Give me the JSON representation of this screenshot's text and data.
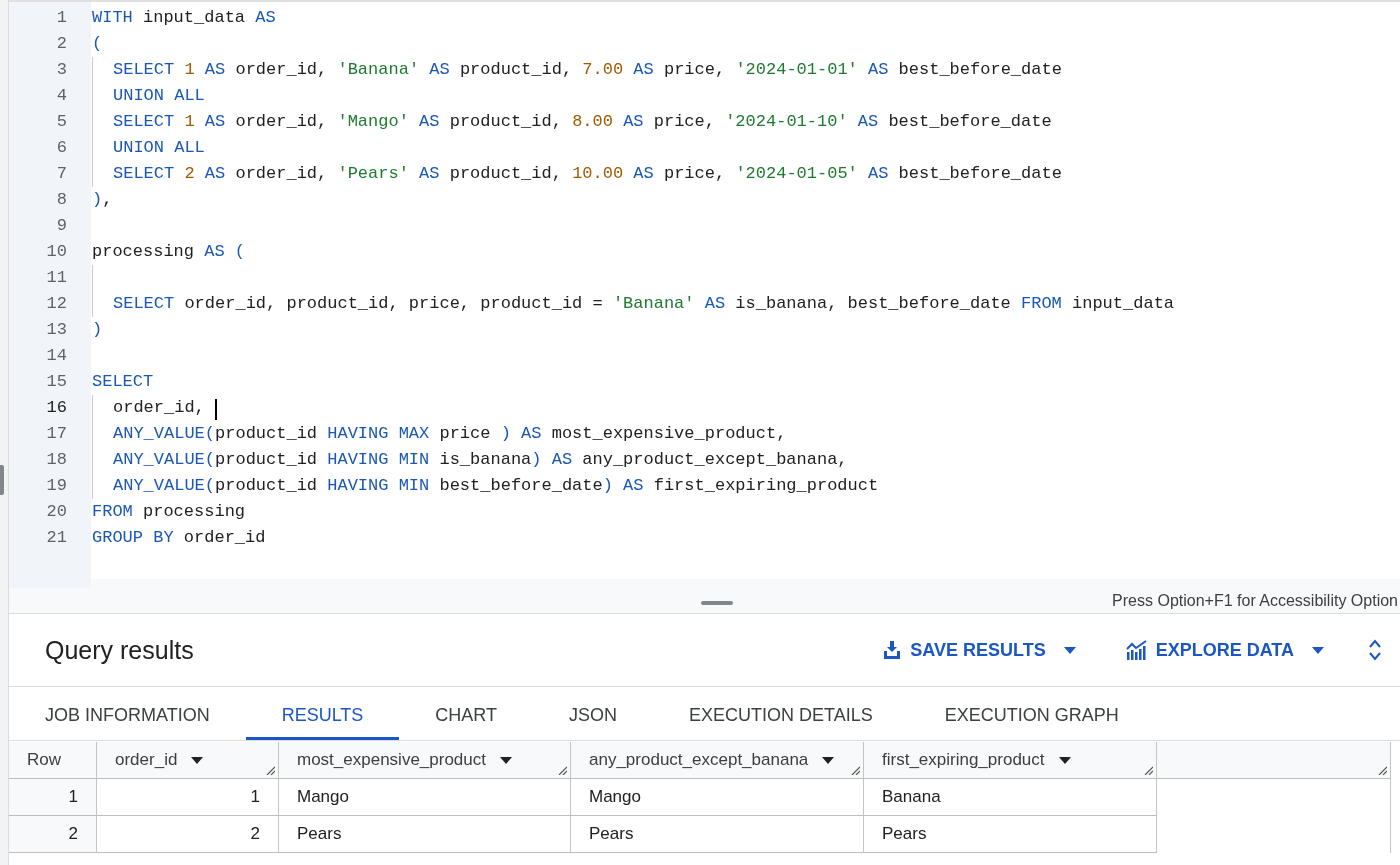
{
  "editor": {
    "lines": [
      {
        "n": "1",
        "indent": false,
        "cursor": false,
        "tokens": [
          {
            "kind": "kw",
            "t": "WITH "
          },
          {
            "kind": "id",
            "t": "input_data "
          },
          {
            "kind": "kw",
            "t": "AS"
          }
        ]
      },
      {
        "n": "2",
        "indent": false,
        "cursor": false,
        "tokens": [
          {
            "kind": "p",
            "t": "("
          }
        ]
      },
      {
        "n": "3",
        "indent": true,
        "cursor": false,
        "tokens": [
          {
            "kind": "kw",
            "t": "SELECT "
          },
          {
            "kind": "num",
            "t": "1 "
          },
          {
            "kind": "kw",
            "t": "AS "
          },
          {
            "kind": "id",
            "t": "order_id, "
          },
          {
            "kind": "str",
            "t": "'Banana' "
          },
          {
            "kind": "kw",
            "t": "AS "
          },
          {
            "kind": "id",
            "t": "product_id, "
          },
          {
            "kind": "num",
            "t": "7.00 "
          },
          {
            "kind": "kw",
            "t": "AS "
          },
          {
            "kind": "id",
            "t": "price, "
          },
          {
            "kind": "str",
            "t": "'2024-01-01' "
          },
          {
            "kind": "kw",
            "t": "AS "
          },
          {
            "kind": "id",
            "t": "best_before_date"
          }
        ]
      },
      {
        "n": "4",
        "indent": true,
        "cursor": false,
        "tokens": [
          {
            "kind": "kw",
            "t": "UNION ALL"
          }
        ]
      },
      {
        "n": "5",
        "indent": true,
        "cursor": false,
        "tokens": [
          {
            "kind": "kw",
            "t": "SELECT "
          },
          {
            "kind": "num",
            "t": "1 "
          },
          {
            "kind": "kw",
            "t": "AS "
          },
          {
            "kind": "id",
            "t": "order_id, "
          },
          {
            "kind": "str",
            "t": "'Mango' "
          },
          {
            "kind": "kw",
            "t": "AS "
          },
          {
            "kind": "id",
            "t": "product_id, "
          },
          {
            "kind": "num",
            "t": "8.00 "
          },
          {
            "kind": "kw",
            "t": "AS "
          },
          {
            "kind": "id",
            "t": "price, "
          },
          {
            "kind": "str",
            "t": "'2024-01-10' "
          },
          {
            "kind": "kw",
            "t": "AS "
          },
          {
            "kind": "id",
            "t": "best_before_date"
          }
        ]
      },
      {
        "n": "6",
        "indent": true,
        "cursor": false,
        "tokens": [
          {
            "kind": "kw",
            "t": "UNION ALL"
          }
        ]
      },
      {
        "n": "7",
        "indent": true,
        "cursor": false,
        "tokens": [
          {
            "kind": "kw",
            "t": "SELECT "
          },
          {
            "kind": "num",
            "t": "2 "
          },
          {
            "kind": "kw",
            "t": "AS "
          },
          {
            "kind": "id",
            "t": "order_id, "
          },
          {
            "kind": "str",
            "t": "'Pears' "
          },
          {
            "kind": "kw",
            "t": "AS "
          },
          {
            "kind": "id",
            "t": "product_id, "
          },
          {
            "kind": "num",
            "t": "10.00 "
          },
          {
            "kind": "kw",
            "t": "AS "
          },
          {
            "kind": "id",
            "t": "price, "
          },
          {
            "kind": "str",
            "t": "'2024-01-05' "
          },
          {
            "kind": "kw",
            "t": "AS "
          },
          {
            "kind": "id",
            "t": "best_before_date"
          }
        ]
      },
      {
        "n": "8",
        "indent": false,
        "cursor": false,
        "tokens": [
          {
            "kind": "p",
            "t": ")"
          },
          {
            "kind": "id",
            "t": ","
          }
        ]
      },
      {
        "n": "9",
        "indent": false,
        "cursor": false
      },
      {
        "n": "10",
        "indent": false,
        "cursor": false,
        "tokens": [
          {
            "kind": "id",
            "t": "processing "
          },
          {
            "kind": "kw",
            "t": "AS "
          },
          {
            "kind": "p",
            "t": "("
          }
        ]
      },
      {
        "n": "11",
        "indent": true,
        "cursor": false
      },
      {
        "n": "12",
        "indent": true,
        "cursor": false,
        "tokens": [
          {
            "kind": "kw",
            "t": "SELECT "
          },
          {
            "kind": "id",
            "t": "order_id, product_id, price, product_id = "
          },
          {
            "kind": "str",
            "t": "'Banana' "
          },
          {
            "kind": "kw",
            "t": "AS "
          },
          {
            "kind": "id",
            "t": "is_banana, best_before_date "
          },
          {
            "kind": "kw",
            "t": "FROM "
          },
          {
            "kind": "id",
            "t": "input_data"
          }
        ]
      },
      {
        "n": "13",
        "indent": false,
        "cursor": false,
        "tokens": [
          {
            "kind": "p",
            "t": ")"
          }
        ]
      },
      {
        "n": "14",
        "indent": false,
        "cursor": false
      },
      {
        "n": "15",
        "indent": false,
        "cursor": false,
        "tokens": [
          {
            "kind": "kw",
            "t": "SELECT"
          }
        ]
      },
      {
        "n": "16",
        "indent": true,
        "cursor": true,
        "tokens": [
          {
            "kind": "id",
            "t": "order_id, "
          }
        ]
      },
      {
        "n": "17",
        "indent": true,
        "cursor": false,
        "tokens": [
          {
            "kind": "kw",
            "t": "ANY_VALUE"
          },
          {
            "kind": "p",
            "t": "("
          },
          {
            "kind": "id",
            "t": "product_id "
          },
          {
            "kind": "kw",
            "t": "HAVING MAX "
          },
          {
            "kind": "id",
            "t": "price "
          },
          {
            "kind": "p",
            "t": ") "
          },
          {
            "kind": "kw",
            "t": "AS "
          },
          {
            "kind": "id",
            "t": "most_expensive_product,"
          }
        ]
      },
      {
        "n": "18",
        "indent": true,
        "cursor": false,
        "tokens": [
          {
            "kind": "kw",
            "t": "ANY_VALUE"
          },
          {
            "kind": "p",
            "t": "("
          },
          {
            "kind": "id",
            "t": "product_id "
          },
          {
            "kind": "kw",
            "t": "HAVING MIN "
          },
          {
            "kind": "id",
            "t": "is_banana"
          },
          {
            "kind": "p",
            "t": ") "
          },
          {
            "kind": "kw",
            "t": "AS "
          },
          {
            "kind": "id",
            "t": "any_product_except_banana,"
          }
        ]
      },
      {
        "n": "19",
        "indent": true,
        "cursor": false,
        "tokens": [
          {
            "kind": "kw",
            "t": "ANY_VALUE"
          },
          {
            "kind": "p",
            "t": "("
          },
          {
            "kind": "id",
            "t": "product_id "
          },
          {
            "kind": "kw",
            "t": "HAVING MIN "
          },
          {
            "kind": "id",
            "t": "best_before_date"
          },
          {
            "kind": "p",
            "t": ") "
          },
          {
            "kind": "kw",
            "t": "AS "
          },
          {
            "kind": "id",
            "t": "first_expiring_product"
          }
        ]
      },
      {
        "n": "20",
        "indent": false,
        "cursor": false,
        "tokens": [
          {
            "kind": "kw",
            "t": "FROM "
          },
          {
            "kind": "id",
            "t": "processing"
          }
        ]
      },
      {
        "n": "21",
        "indent": false,
        "cursor": false,
        "tokens": [
          {
            "kind": "kw",
            "t": "GROUP BY "
          },
          {
            "kind": "id",
            "t": "order_id"
          }
        ]
      }
    ]
  },
  "status_bar": {
    "hint": "Press Option+F1 for Accessibility Option"
  },
  "results": {
    "title": "Query results",
    "actions": [
      {
        "kind": "save",
        "label": "SAVE RESULTS"
      },
      {
        "kind": "explore",
        "label": "EXPLORE DATA"
      }
    ],
    "tabs": [
      {
        "label": "JOB INFORMATION",
        "selected": false
      },
      {
        "label": "RESULTS",
        "selected": true
      },
      {
        "label": "CHART",
        "selected": false
      },
      {
        "label": "JSON",
        "selected": false
      },
      {
        "label": "EXECUTION DETAILS",
        "selected": false
      },
      {
        "label": "EXECUTION GRAPH",
        "selected": false
      }
    ],
    "table": {
      "columns": [
        {
          "label": "Row",
          "menu": false,
          "kind": "number"
        },
        {
          "label": "order_id",
          "menu": true,
          "kind": "number"
        },
        {
          "label": "most_expensive_product",
          "menu": true,
          "kind": "text"
        },
        {
          "label": "any_product_except_banana",
          "menu": true,
          "kind": "text"
        },
        {
          "label": "first_expiring_product",
          "menu": true,
          "kind": "text"
        }
      ],
      "rows": [
        {
          "cells": [
            "1",
            "1",
            "Mango",
            "Mango",
            "Banana"
          ]
        },
        {
          "cells": [
            "2",
            "2",
            "Pears",
            "Pears",
            "Pears"
          ]
        }
      ]
    }
  }
}
